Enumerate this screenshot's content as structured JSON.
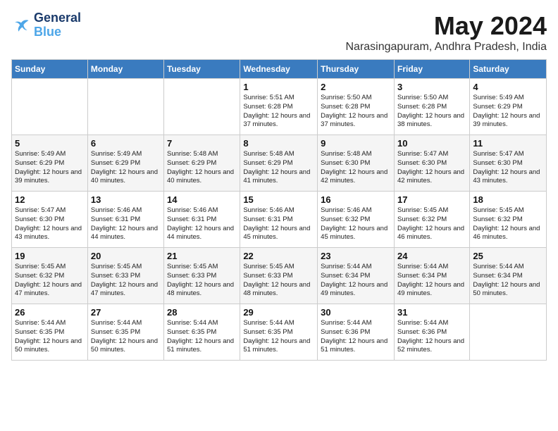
{
  "header": {
    "logo_line1": "General",
    "logo_line2": "Blue",
    "month": "May 2024",
    "location": "Narasingapuram, Andhra Pradesh, India"
  },
  "days_of_week": [
    "Sunday",
    "Monday",
    "Tuesday",
    "Wednesday",
    "Thursday",
    "Friday",
    "Saturday"
  ],
  "weeks": [
    [
      {
        "day": "",
        "sunrise": "",
        "sunset": "",
        "daylight": ""
      },
      {
        "day": "",
        "sunrise": "",
        "sunset": "",
        "daylight": ""
      },
      {
        "day": "",
        "sunrise": "",
        "sunset": "",
        "daylight": ""
      },
      {
        "day": "1",
        "sunrise": "Sunrise: 5:51 AM",
        "sunset": "Sunset: 6:28 PM",
        "daylight": "Daylight: 12 hours and 37 minutes."
      },
      {
        "day": "2",
        "sunrise": "Sunrise: 5:50 AM",
        "sunset": "Sunset: 6:28 PM",
        "daylight": "Daylight: 12 hours and 37 minutes."
      },
      {
        "day": "3",
        "sunrise": "Sunrise: 5:50 AM",
        "sunset": "Sunset: 6:28 PM",
        "daylight": "Daylight: 12 hours and 38 minutes."
      },
      {
        "day": "4",
        "sunrise": "Sunrise: 5:49 AM",
        "sunset": "Sunset: 6:29 PM",
        "daylight": "Daylight: 12 hours and 39 minutes."
      }
    ],
    [
      {
        "day": "5",
        "sunrise": "Sunrise: 5:49 AM",
        "sunset": "Sunset: 6:29 PM",
        "daylight": "Daylight: 12 hours and 39 minutes."
      },
      {
        "day": "6",
        "sunrise": "Sunrise: 5:49 AM",
        "sunset": "Sunset: 6:29 PM",
        "daylight": "Daylight: 12 hours and 40 minutes."
      },
      {
        "day": "7",
        "sunrise": "Sunrise: 5:48 AM",
        "sunset": "Sunset: 6:29 PM",
        "daylight": "Daylight: 12 hours and 40 minutes."
      },
      {
        "day": "8",
        "sunrise": "Sunrise: 5:48 AM",
        "sunset": "Sunset: 6:29 PM",
        "daylight": "Daylight: 12 hours and 41 minutes."
      },
      {
        "day": "9",
        "sunrise": "Sunrise: 5:48 AM",
        "sunset": "Sunset: 6:30 PM",
        "daylight": "Daylight: 12 hours and 42 minutes."
      },
      {
        "day": "10",
        "sunrise": "Sunrise: 5:47 AM",
        "sunset": "Sunset: 6:30 PM",
        "daylight": "Daylight: 12 hours and 42 minutes."
      },
      {
        "day": "11",
        "sunrise": "Sunrise: 5:47 AM",
        "sunset": "Sunset: 6:30 PM",
        "daylight": "Daylight: 12 hours and 43 minutes."
      }
    ],
    [
      {
        "day": "12",
        "sunrise": "Sunrise: 5:47 AM",
        "sunset": "Sunset: 6:30 PM",
        "daylight": "Daylight: 12 hours and 43 minutes."
      },
      {
        "day": "13",
        "sunrise": "Sunrise: 5:46 AM",
        "sunset": "Sunset: 6:31 PM",
        "daylight": "Daylight: 12 hours and 44 minutes."
      },
      {
        "day": "14",
        "sunrise": "Sunrise: 5:46 AM",
        "sunset": "Sunset: 6:31 PM",
        "daylight": "Daylight: 12 hours and 44 minutes."
      },
      {
        "day": "15",
        "sunrise": "Sunrise: 5:46 AM",
        "sunset": "Sunset: 6:31 PM",
        "daylight": "Daylight: 12 hours and 45 minutes."
      },
      {
        "day": "16",
        "sunrise": "Sunrise: 5:46 AM",
        "sunset": "Sunset: 6:32 PM",
        "daylight": "Daylight: 12 hours and 45 minutes."
      },
      {
        "day": "17",
        "sunrise": "Sunrise: 5:45 AM",
        "sunset": "Sunset: 6:32 PM",
        "daylight": "Daylight: 12 hours and 46 minutes."
      },
      {
        "day": "18",
        "sunrise": "Sunrise: 5:45 AM",
        "sunset": "Sunset: 6:32 PM",
        "daylight": "Daylight: 12 hours and 46 minutes."
      }
    ],
    [
      {
        "day": "19",
        "sunrise": "Sunrise: 5:45 AM",
        "sunset": "Sunset: 6:32 PM",
        "daylight": "Daylight: 12 hours and 47 minutes."
      },
      {
        "day": "20",
        "sunrise": "Sunrise: 5:45 AM",
        "sunset": "Sunset: 6:33 PM",
        "daylight": "Daylight: 12 hours and 47 minutes."
      },
      {
        "day": "21",
        "sunrise": "Sunrise: 5:45 AM",
        "sunset": "Sunset: 6:33 PM",
        "daylight": "Daylight: 12 hours and 48 minutes."
      },
      {
        "day": "22",
        "sunrise": "Sunrise: 5:45 AM",
        "sunset": "Sunset: 6:33 PM",
        "daylight": "Daylight: 12 hours and 48 minutes."
      },
      {
        "day": "23",
        "sunrise": "Sunrise: 5:44 AM",
        "sunset": "Sunset: 6:34 PM",
        "daylight": "Daylight: 12 hours and 49 minutes."
      },
      {
        "day": "24",
        "sunrise": "Sunrise: 5:44 AM",
        "sunset": "Sunset: 6:34 PM",
        "daylight": "Daylight: 12 hours and 49 minutes."
      },
      {
        "day": "25",
        "sunrise": "Sunrise: 5:44 AM",
        "sunset": "Sunset: 6:34 PM",
        "daylight": "Daylight: 12 hours and 50 minutes."
      }
    ],
    [
      {
        "day": "26",
        "sunrise": "Sunrise: 5:44 AM",
        "sunset": "Sunset: 6:35 PM",
        "daylight": "Daylight: 12 hours and 50 minutes."
      },
      {
        "day": "27",
        "sunrise": "Sunrise: 5:44 AM",
        "sunset": "Sunset: 6:35 PM",
        "daylight": "Daylight: 12 hours and 50 minutes."
      },
      {
        "day": "28",
        "sunrise": "Sunrise: 5:44 AM",
        "sunset": "Sunset: 6:35 PM",
        "daylight": "Daylight: 12 hours and 51 minutes."
      },
      {
        "day": "29",
        "sunrise": "Sunrise: 5:44 AM",
        "sunset": "Sunset: 6:35 PM",
        "daylight": "Daylight: 12 hours and 51 minutes."
      },
      {
        "day": "30",
        "sunrise": "Sunrise: 5:44 AM",
        "sunset": "Sunset: 6:36 PM",
        "daylight": "Daylight: 12 hours and 51 minutes."
      },
      {
        "day": "31",
        "sunrise": "Sunrise: 5:44 AM",
        "sunset": "Sunset: 6:36 PM",
        "daylight": "Daylight: 12 hours and 52 minutes."
      },
      {
        "day": "",
        "sunrise": "",
        "sunset": "",
        "daylight": ""
      }
    ]
  ]
}
